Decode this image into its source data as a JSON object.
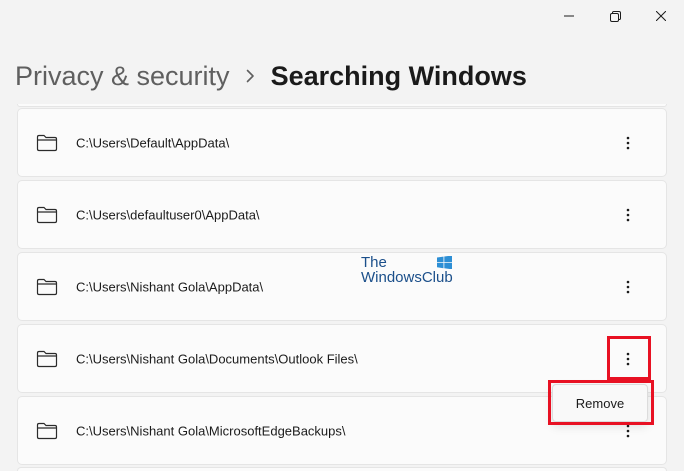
{
  "window_controls": {
    "minimize_icon": "minimize-icon",
    "restore_icon": "restore-icon",
    "close_icon": "close-icon"
  },
  "breadcrumb": {
    "parent": "Privacy & security",
    "separator_icon": "chevron-right-icon",
    "current": "Searching Windows"
  },
  "excluded_folders": [
    {
      "path": "C:\\Users\\Default\\AppData\\",
      "icon": "folder-icon"
    },
    {
      "path": "C:\\Users\\defaultuser0\\AppData\\",
      "icon": "folder-icon"
    },
    {
      "path": "C:\\Users\\Nishant Gola\\AppData\\",
      "icon": "folder-icon"
    },
    {
      "path": "C:\\Users\\Nishant Gola\\Documents\\Outlook Files\\",
      "icon": "folder-icon"
    },
    {
      "path": "C:\\Users\\Nishant Gola\\MicrosoftEdgeBackups\\",
      "icon": "folder-icon"
    }
  ],
  "context_menu": {
    "items": [
      "Remove"
    ]
  },
  "watermark": {
    "line1": "The",
    "line2": "WindowsClub"
  },
  "colors": {
    "highlight": "#e81123",
    "background": "#f3f3f3",
    "card": "#fbfbfb"
  }
}
